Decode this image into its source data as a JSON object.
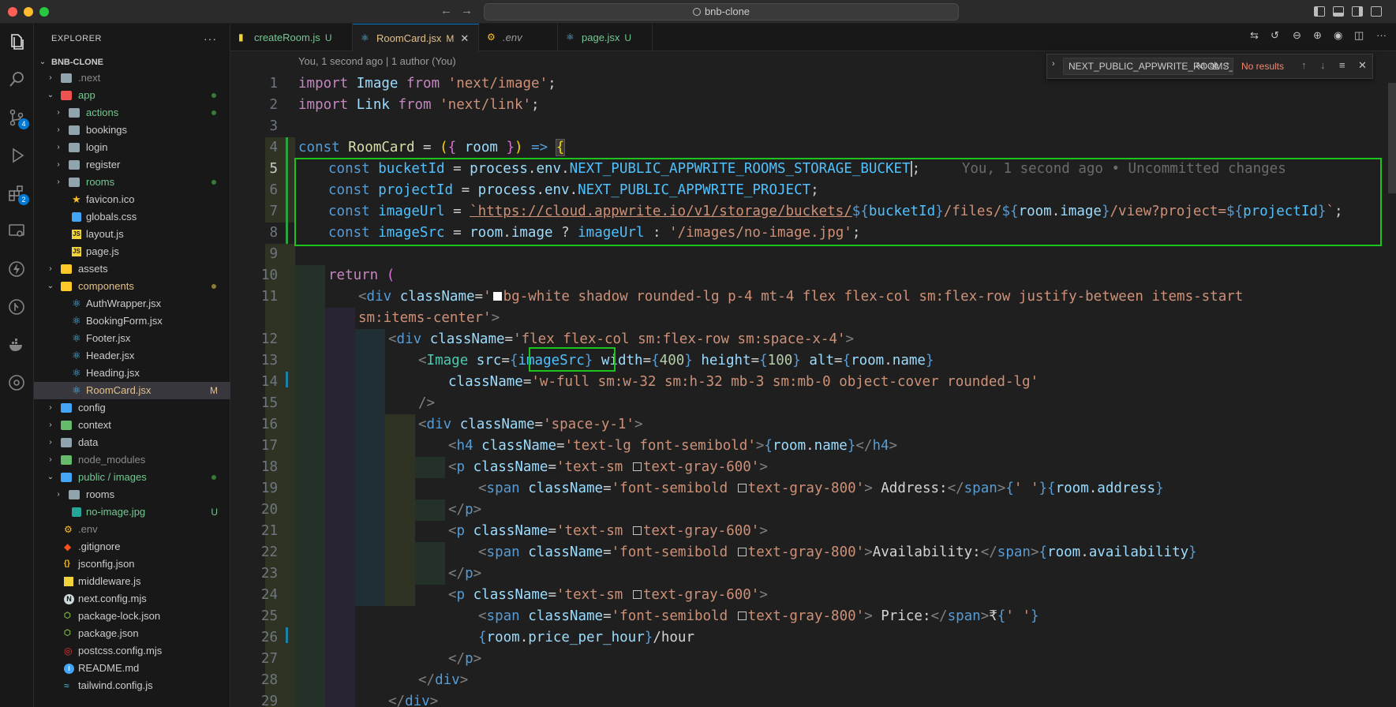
{
  "window": {
    "search_title": "bnb-clone"
  },
  "activity_bar": {
    "scm_badge": "4",
    "extensions_badge": "2"
  },
  "explorer": {
    "header": "EXPLORER",
    "root": "BNB-CLONE",
    "items": [
      {
        "label": ".next",
        "status": ""
      },
      {
        "label": "app",
        "status": ""
      },
      {
        "label": "actions",
        "status": ""
      },
      {
        "label": "bookings",
        "status": ""
      },
      {
        "label": "login",
        "status": ""
      },
      {
        "label": "register",
        "status": ""
      },
      {
        "label": "rooms",
        "status": ""
      },
      {
        "label": "favicon.ico",
        "status": ""
      },
      {
        "label": "globals.css",
        "status": ""
      },
      {
        "label": "layout.js",
        "status": ""
      },
      {
        "label": "page.js",
        "status": ""
      },
      {
        "label": "assets",
        "status": ""
      },
      {
        "label": "components",
        "status": ""
      },
      {
        "label": "AuthWrapper.jsx",
        "status": ""
      },
      {
        "label": "BookingForm.jsx",
        "status": ""
      },
      {
        "label": "Footer.jsx",
        "status": ""
      },
      {
        "label": "Header.jsx",
        "status": ""
      },
      {
        "label": "Heading.jsx",
        "status": ""
      },
      {
        "label": "RoomCard.jsx",
        "status": "M"
      },
      {
        "label": "config",
        "status": ""
      },
      {
        "label": "context",
        "status": ""
      },
      {
        "label": "data",
        "status": ""
      },
      {
        "label": "node_modules",
        "status": ""
      },
      {
        "label": "public / images",
        "status": ""
      },
      {
        "label": "rooms",
        "status": ""
      },
      {
        "label": "no-image.jpg",
        "status": "U"
      },
      {
        "label": ".env",
        "status": ""
      },
      {
        "label": ".gitignore",
        "status": ""
      },
      {
        "label": "jsconfig.json",
        "status": ""
      },
      {
        "label": "middleware.js",
        "status": ""
      },
      {
        "label": "next.config.mjs",
        "status": ""
      },
      {
        "label": "package-lock.json",
        "status": ""
      },
      {
        "label": "package.json",
        "status": ""
      },
      {
        "label": "postcss.config.mjs",
        "status": ""
      },
      {
        "label": "README.md",
        "status": ""
      },
      {
        "label": "tailwind.config.js",
        "status": ""
      }
    ]
  },
  "tabs": [
    {
      "label": "createRoom.js",
      "status": "U"
    },
    {
      "label": "RoomCard.jsx",
      "status": "M"
    },
    {
      "label": ".env",
      "status": ""
    },
    {
      "label": "page.jsx",
      "status": "U"
    }
  ],
  "editor": {
    "blame_header": "You, 1 second ago | 1 author (You)",
    "inline_blame": "You, 1 second ago • Uncommitted changes",
    "line_numbers": [
      "1",
      "2",
      "3",
      "4",
      "5",
      "6",
      "7",
      "8",
      "9",
      "10",
      "11",
      "",
      "12",
      "13",
      "14",
      "15",
      "16",
      "17",
      "18",
      "19",
      "20",
      "21",
      "22",
      "23",
      "24",
      "25",
      "26",
      "27",
      "28",
      "29"
    ]
  },
  "find": {
    "query": "NEXT_PUBLIC_APPWRITE_ROOMS_STORAGE_BUCKET",
    "opt_case": "Aa",
    "opt_word": "ab",
    "opt_regex": ".*",
    "result": "No results"
  },
  "code": {
    "l1": [
      "import",
      " Image ",
      "from",
      " 'next/image'",
      ";"
    ],
    "l2": [
      "import",
      " Link ",
      "from",
      " 'next/link'",
      ";"
    ],
    "l4": [
      "const",
      " RoomCard",
      " = ",
      "(",
      "{",
      " room ",
      "}",
      ")",
      " => ",
      "{"
    ],
    "l5": [
      "const",
      "bucketId",
      " = ",
      "process",
      ".",
      "env",
      ".",
      "NEXT_PUBLIC_APPWRITE_ROOMS_STORAGE_BUCKET",
      ";"
    ],
    "l6": [
      "const",
      "projectId",
      " = ",
      "process",
      ".",
      "env",
      ".",
      "NEXT_PUBLIC_APPWRITE_PROJECT",
      ";"
    ],
    "l7": [
      "const",
      "imageUrl",
      " = ",
      "`https://cloud.appwrite.io/v1/storage/buckets/",
      "${",
      "bucketId",
      "}",
      "/files/",
      "${",
      "room",
      ".",
      "image",
      "}",
      "/view?project=",
      "${",
      "projectId",
      "}",
      "`",
      ";"
    ],
    "l8": [
      "const",
      "imageSrc",
      " = ",
      "room",
      ".",
      "image",
      " ? ",
      "imageUrl",
      " : ",
      "'/images/no-image.jpg'",
      ";"
    ],
    "l10": [
      "return",
      " ("
    ],
    "l11a": [
      "<",
      "div",
      "className",
      "=",
      "'",
      "bg-white shadow rounded-lg p-4 mt-4 flex flex-col sm:flex-row justify-between items-start"
    ],
    "l11b": [
      "sm:items-center'",
      ">"
    ],
    "l12": [
      "<",
      "div",
      "className",
      "=",
      "'flex flex-col sm:flex-row sm:space-x-4'",
      ">"
    ],
    "l13": [
      "<",
      "Image",
      "src",
      "=",
      "{",
      "imageSrc",
      "}",
      "width",
      "=",
      "{",
      "400",
      "}",
      "height",
      "=",
      "{",
      "100",
      "}",
      "alt",
      "=",
      "{",
      "room",
      ".",
      "name",
      "}"
    ],
    "l14": [
      "className",
      "=",
      "'w-full sm:w-32 sm:h-32 mb-3 sm:mb-0 object-cover rounded-lg'"
    ],
    "l15": [
      "/>"
    ],
    "l16": [
      "<",
      "div",
      "className",
      "=",
      "'space-y-1'",
      ">"
    ],
    "l17": [
      "<",
      "h4",
      "className",
      "=",
      "'text-lg font-semibold'",
      ">",
      "{",
      "room",
      ".",
      "name",
      "}",
      "</",
      "h4",
      ">"
    ],
    "l18": [
      "<",
      "p",
      "className",
      "=",
      "'text-sm ",
      "text-gray-600'",
      ">"
    ],
    "l19": [
      "<",
      "span",
      "className",
      "=",
      "'font-semibold ",
      "text-gray-800'",
      ">",
      " Address:",
      "</",
      "span",
      ">",
      "{",
      "' '",
      "}",
      "{",
      "room",
      ".",
      "address",
      "}"
    ],
    "l20": [
      "</",
      "p",
      ">"
    ],
    "l21": [
      "<",
      "p",
      "className",
      "=",
      "'text-sm ",
      "text-gray-600'",
      ">"
    ],
    "l22": [
      "<",
      "span",
      "className",
      "=",
      "'font-semibold ",
      "text-gray-800'",
      ">",
      "Availability:",
      "</",
      "span",
      ">",
      "{",
      "room",
      ".",
      "availability",
      "}"
    ],
    "l23": [
      "</",
      "p",
      ">"
    ],
    "l24": [
      "<",
      "p",
      "className",
      "=",
      "'text-sm ",
      "text-gray-600'",
      ">"
    ],
    "l25": [
      "<",
      "span",
      "className",
      "=",
      "'font-semibold ",
      "text-gray-800'",
      ">",
      " Price:",
      "</",
      "span",
      ">",
      "₹",
      "{",
      "' '",
      "}"
    ],
    "l26": [
      "{",
      "room",
      ".",
      "price_per_hour",
      "}",
      "/hour"
    ],
    "l27": [
      "</",
      "p",
      ">"
    ],
    "l28": [
      "</",
      "div",
      ">"
    ],
    "l29": [
      "</",
      "div",
      ">"
    ]
  }
}
